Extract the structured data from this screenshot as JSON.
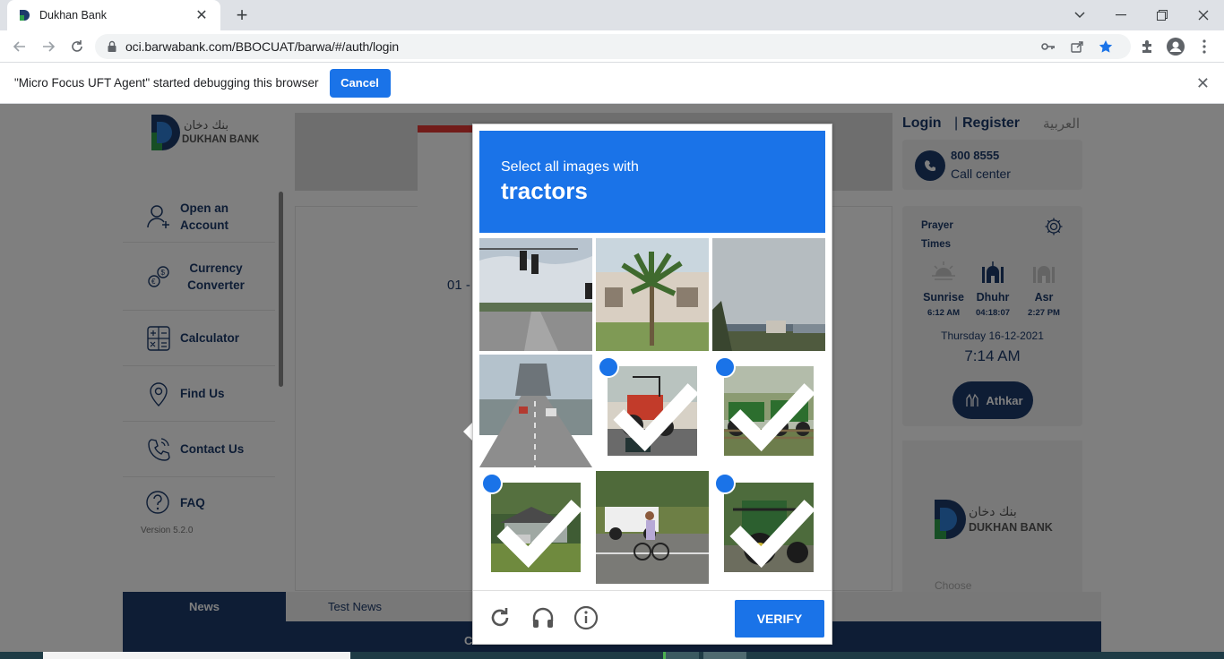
{
  "browser": {
    "tab_title": "Dukhan Bank",
    "url": "oci.barwabank.com/BBOCUAT/barwa/#/auth/login"
  },
  "infobar": {
    "message": "\"Micro Focus UFT Agent\" started debugging this browser",
    "cancel_label": "Cancel"
  },
  "sidebar": {
    "logo_text_en": "DUKHAN BANK",
    "logo_text_ar": "بنك دخان",
    "items": [
      {
        "label": "Open an Account",
        "icon": "add-user-icon"
      },
      {
        "label": "Currency Converter",
        "icon": "currency-exchange-icon"
      },
      {
        "label": "Calculator",
        "icon": "calculator-icon"
      },
      {
        "label": "Find Us",
        "icon": "location-pin-icon"
      },
      {
        "label": "Contact Us",
        "icon": "phone-icon"
      },
      {
        "label": "FAQ",
        "icon": "question-icon"
      }
    ],
    "version": "Version 5.2.0"
  },
  "main": {
    "login_fragment": "01 -"
  },
  "right": {
    "login": "Login",
    "separator": "|",
    "register": "Register",
    "arabic": "العربية",
    "call_number": "800 8555",
    "call_label": "Call center",
    "prayer_title": "Prayer Times",
    "prayers": [
      {
        "name": "Sunrise",
        "time": "6:12 AM"
      },
      {
        "name": "Dhuhr",
        "time": "04:18:07"
      },
      {
        "name": "Asr",
        "time": "2:27 PM"
      }
    ],
    "date": "Thursday 16-12-2021",
    "clock": "7:14 AM",
    "athkar": "Athkar",
    "ad_choose": "Choose"
  },
  "news": {
    "label": "News",
    "item": "Test News",
    "footer_fragment": "C"
  },
  "captcha": {
    "line1": "Select all images with",
    "target": "tractors",
    "verify_label": "VERIFY",
    "selected": [
      false,
      false,
      false,
      false,
      true,
      true,
      true,
      false,
      true
    ]
  },
  "colors": {
    "captcha_blue": "#1a73e8",
    "bank_navy": "#1c3a6b",
    "accent_red": "#e53935"
  }
}
